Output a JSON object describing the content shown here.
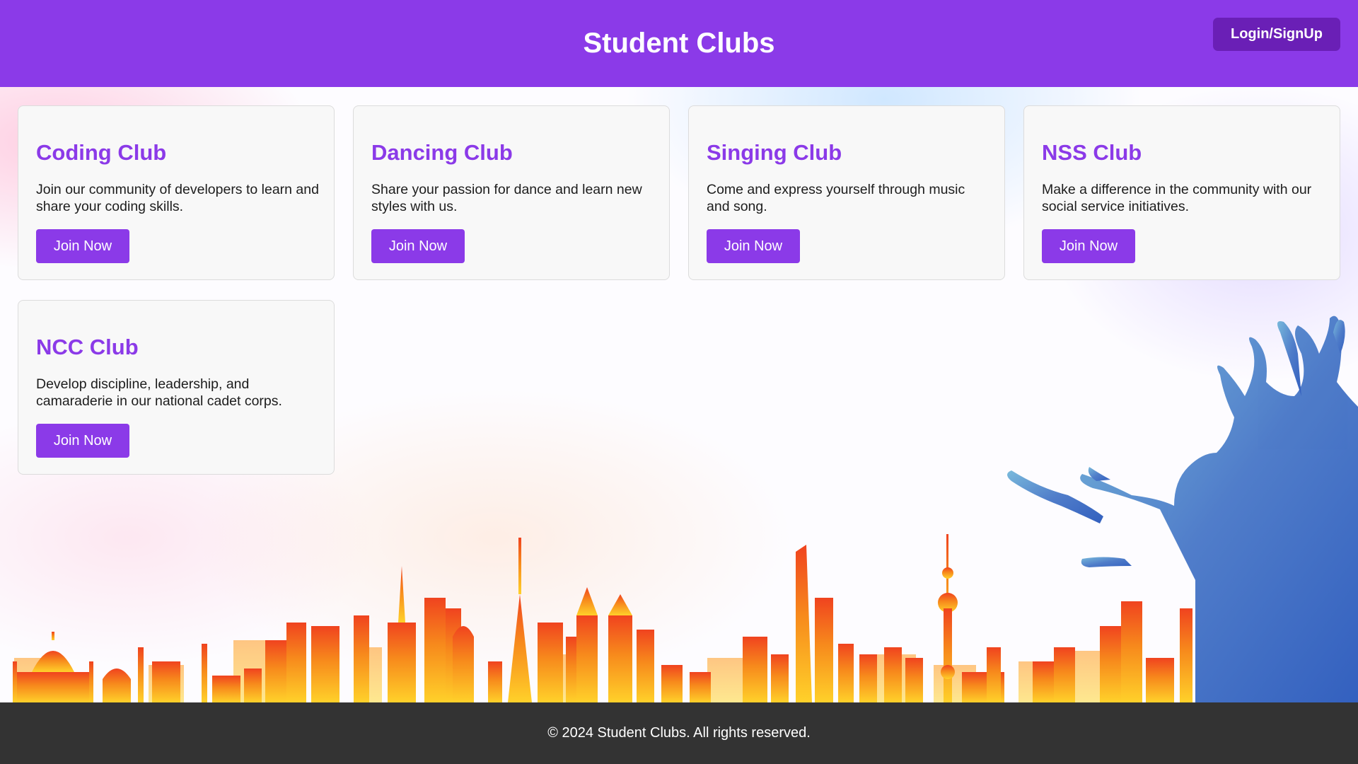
{
  "header": {
    "title": "Student Clubs",
    "login_label": "Login/SignUp"
  },
  "clubs": [
    {
      "name": "Coding Club",
      "description": "Join our community of developers to learn and share your coding skills.",
      "button_label": "Join Now"
    },
    {
      "name": "Dancing Club",
      "description": "Share your passion for dance and learn new styles with us.",
      "button_label": "Join Now"
    },
    {
      "name": "Singing Club",
      "description": "Come and express yourself through music and song.",
      "button_label": "Join Now"
    },
    {
      "name": "NSS Club",
      "description": "Make a difference in the community with our social service initiatives.",
      "button_label": "Join Now"
    },
    {
      "name": "NCC Club",
      "description": "Develop discipline, leadership, and camaraderie in our national cadet corps.",
      "button_label": "Join Now"
    }
  ],
  "footer": {
    "text": "© 2024 Student Clubs. All rights reserved."
  },
  "colors": {
    "accent": "#8b3ae8",
    "login_button": "#6a1fb6",
    "footer_bg": "#333333",
    "card_bg": "#f8f8f8"
  }
}
